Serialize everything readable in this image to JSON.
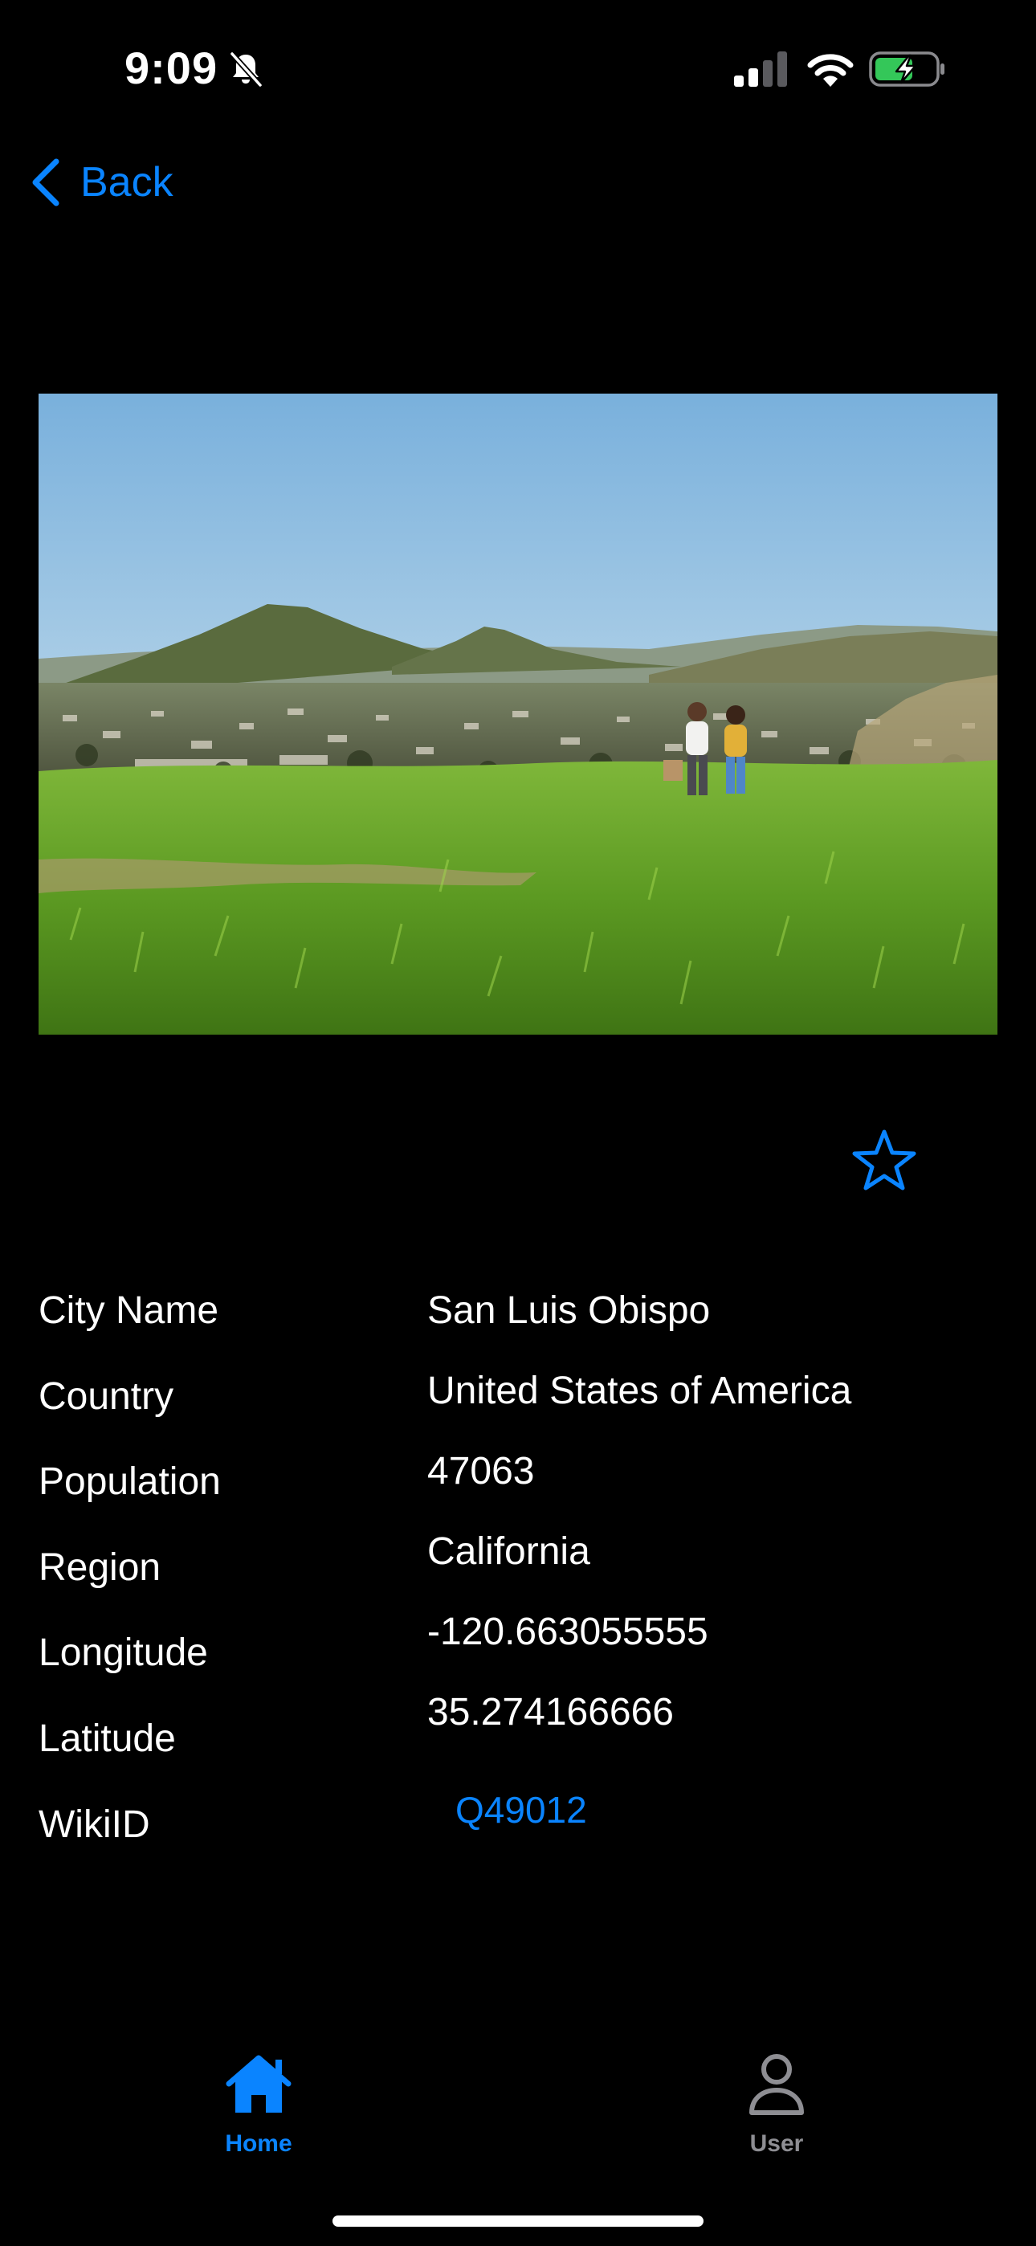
{
  "status_bar": {
    "time": "9:09",
    "icons": [
      "bell-slash-icon",
      "cellular-signal-icon",
      "wifi-icon",
      "battery-charging-icon"
    ]
  },
  "navigation": {
    "back_label": "Back",
    "back_icon": "chevron-left-icon"
  },
  "photo": {
    "description_icon": "city-landscape-photo"
  },
  "favorite": {
    "icon": "star-outline-icon",
    "selected": false
  },
  "details": {
    "city_name": {
      "label": "City Name",
      "value": "San Luis Obispo"
    },
    "country": {
      "label": "Country",
      "value": "United States of America"
    },
    "population": {
      "label": "Population",
      "value": "47063"
    },
    "region": {
      "label": "Region",
      "value": "California"
    },
    "longitude": {
      "label": "Longitude",
      "value": "-120.663055555"
    },
    "latitude": {
      "label": "Latitude",
      "value": "35.274166666"
    },
    "wikiid": {
      "label": "WikiID",
      "value": "Q49012"
    }
  },
  "tab_bar": {
    "home": {
      "label": "Home",
      "icon": "house-icon",
      "selected": true
    },
    "user": {
      "label": "User",
      "icon": "person-icon",
      "selected": false
    }
  },
  "colors": {
    "accent": "#0a84ff",
    "background": "#000000",
    "text": "#ffffff",
    "inactive_tab": "#8e8e93",
    "battery_green": "#34c759"
  }
}
